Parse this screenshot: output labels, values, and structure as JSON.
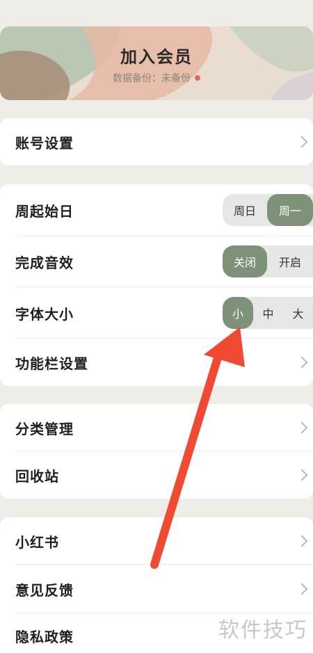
{
  "member": {
    "title": "加入会员",
    "backup_status": "数据备份：未备份"
  },
  "section1": {
    "account_settings": "账号设置"
  },
  "section2": {
    "week_start": {
      "label": "周起始日",
      "options": [
        "周日",
        "周一"
      ],
      "selected": "周一"
    },
    "completion_sound": {
      "label": "完成音效",
      "options": [
        "关闭",
        "开启"
      ],
      "selected": "关闭"
    },
    "font_size": {
      "label": "字体大小",
      "options": [
        "小",
        "中",
        "大"
      ],
      "selected": "小"
    },
    "toolbar_settings": "功能栏设置"
  },
  "section3": {
    "category_management": "分类管理",
    "recycle_bin": "回收站"
  },
  "section4": {
    "xiaohongshu": "小红书",
    "feedback": "意见反馈",
    "privacy_policy": "隐私政策"
  },
  "watermark": "软件技巧",
  "colors": {
    "background": "#efede8",
    "accent_green": "#7d9279",
    "arrow_red": "#f04a32",
    "status_red": "#e5675a"
  }
}
